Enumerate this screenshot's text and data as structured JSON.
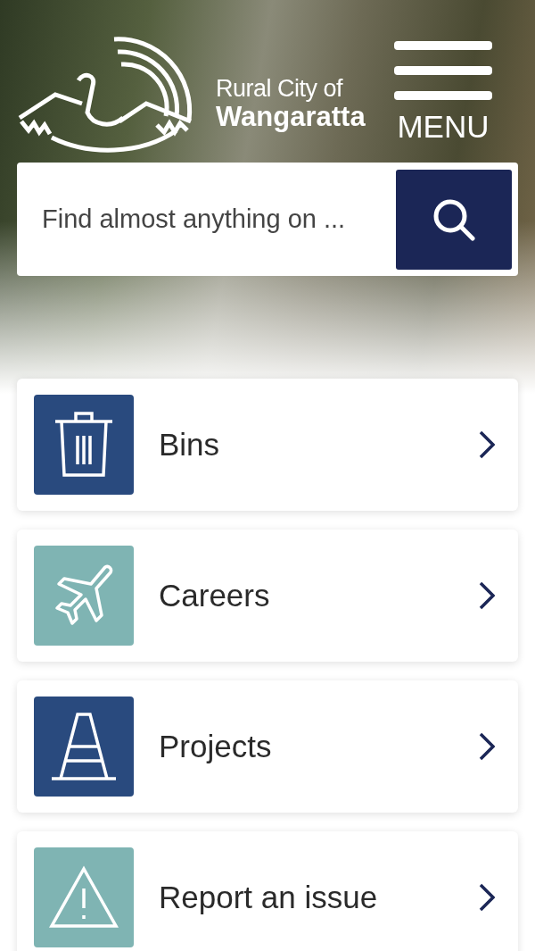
{
  "header": {
    "logo_line1": "Rural City of",
    "logo_line2": "Wangaratta",
    "menu_label": "MENU"
  },
  "search": {
    "placeholder": "Find almost anything on ..."
  },
  "quick_links": [
    {
      "label": "Bins",
      "kind": "bin",
      "color": "#294a7e"
    },
    {
      "label": "Careers",
      "kind": "plane",
      "color": "#7fb4b3"
    },
    {
      "label": "Projects",
      "kind": "cone",
      "color": "#294a7e"
    },
    {
      "label": "Report an issue",
      "kind": "warning",
      "color": "#7fb4b3"
    }
  ]
}
